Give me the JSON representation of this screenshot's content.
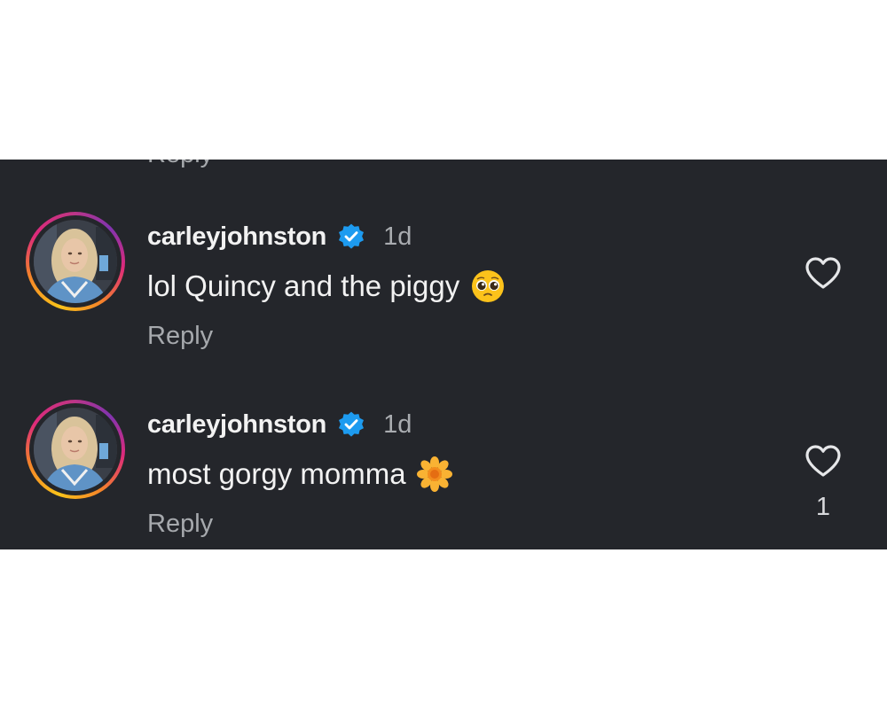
{
  "colors": {
    "background": "#24262b",
    "text_primary": "#f2f2f2",
    "text_secondary": "#a6a9ad",
    "verified_blue": "#1d9bf0",
    "story_ring": [
      "#f9c21a",
      "#f58529",
      "#dd2a7b",
      "#8134af"
    ]
  },
  "clipped_previous_reply": "Reply",
  "comments": [
    {
      "username": "carleyjohnston",
      "verified": true,
      "verified_icon": "verified-badge-icon",
      "time": "1d",
      "text": "lol Quincy and the piggy",
      "emoji": "pleading-face-emoji",
      "reply_label": "Reply",
      "like_icon": "heart-outline-icon",
      "like_count": ""
    },
    {
      "username": "carleyjohnston",
      "verified": true,
      "verified_icon": "verified-badge-icon",
      "time": "1d",
      "text": "most gorgy momma",
      "emoji": "blossom-emoji",
      "reply_label": "Reply",
      "like_icon": "heart-outline-icon",
      "like_count": "1"
    }
  ]
}
